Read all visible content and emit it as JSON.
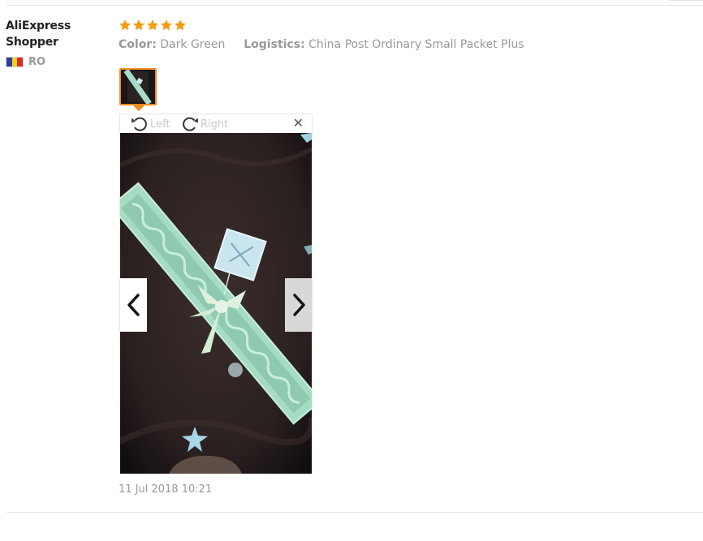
{
  "review": {
    "user_name": "AliExpress Shopper",
    "country_code": "RO",
    "flag_colors": [
      "#2b3f9e",
      "#f2d21c",
      "#d62b2b"
    ],
    "rating": 5,
    "star_color": "#f59a12",
    "color_label": "Color:",
    "color_value": "Dark Green",
    "logistics_label": "Logistics:",
    "logistics_value": "China Post Ordinary Small Packet Plus",
    "date": "11 Jul 2018 10:21"
  },
  "viewer": {
    "rotate_left_label": "Left",
    "rotate_right_label": "Right",
    "close_symbol": "✕",
    "close_icon": "close-icon",
    "prev_icon": "chevron-left-icon",
    "next_icon": "chevron-right-icon",
    "rotate_left_icon": "rotate-left-icon",
    "rotate_right_icon": "rotate-right-icon"
  },
  "accent_color": "#f38a1f"
}
